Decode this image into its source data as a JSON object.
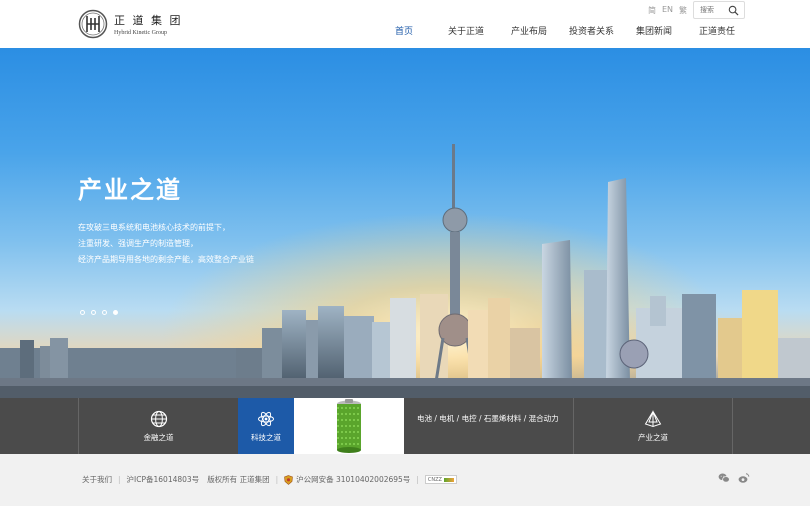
{
  "header": {
    "logo_cn": "正 道 集 团",
    "logo_en": "Hybrid Kinetic Group",
    "languages": [
      "简",
      "EN",
      "繁"
    ],
    "search_placeholder": "搜索"
  },
  "nav": {
    "items": [
      "首页",
      "关于正道",
      "产业布局",
      "投资者关系",
      "集团新闻",
      "正道责任"
    ],
    "active": "首页"
  },
  "hero": {
    "title": "产业之道",
    "lines": [
      "在攻破三电系统和电池核心技术的前提下，",
      "注重研发、强调生产的制造管理，",
      "经济产品期导用各地的剩余产能，高效整合产业链"
    ],
    "slide_count": 4,
    "active_slide": 4
  },
  "features": {
    "finance": "金融之道",
    "tech": "科技之道",
    "list_text": "电池 / 电机 / 电控 / 石墨烯材料 / 混合动力",
    "industry": "产业之道"
  },
  "footer": {
    "about": "关于我们",
    "icp": "沪ICP备16014803号",
    "copyright": "版权所有 正道集团",
    "police": "沪公网安备 31010402002695号",
    "badge": "CNZZ"
  },
  "colors": {
    "accent": "#1d5aa8",
    "feature_bar": "#4b4b4b",
    "footer_bg": "#f1f1f1"
  }
}
